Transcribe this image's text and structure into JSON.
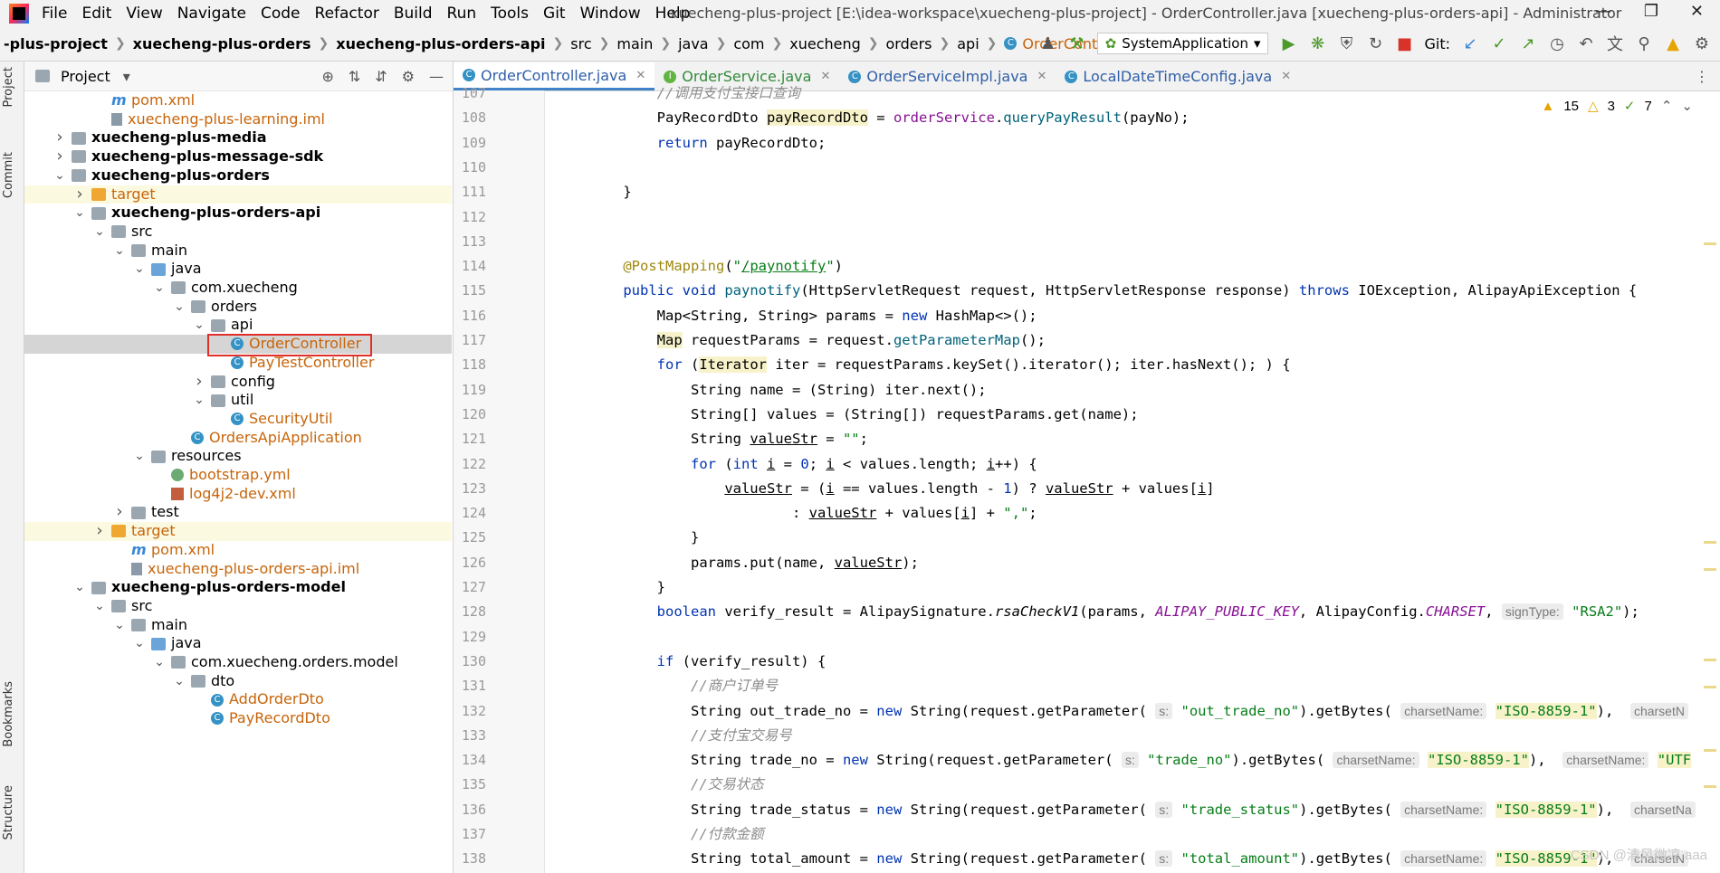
{
  "menubar": {
    "items": [
      "File",
      "Edit",
      "View",
      "Navigate",
      "Code",
      "Refactor",
      "Build",
      "Run",
      "Tools",
      "Git",
      "Window",
      "Help"
    ],
    "window_title": "xuecheng-plus-project [E:\\idea-workspace\\xuecheng-plus-project] - OrderController.java [xuecheng-plus-orders-api] - Administrator"
  },
  "breadcrumbs": [
    "-plus-project",
    "xuecheng-plus-orders",
    "xuecheng-plus-orders-api",
    "src",
    "main",
    "java",
    "com",
    "xuecheng",
    "orders",
    "api",
    "OrderController"
  ],
  "toolbar": {
    "run_config": "SystemApplication",
    "git_label": "Git:"
  },
  "side_tabs": {
    "project": "Project",
    "commit": "Commit",
    "bookmarks": "Bookmarks",
    "structure": "Structure"
  },
  "project_panel": {
    "title": "Project",
    "tree": [
      {
        "text": "pom.xml",
        "indent": 3,
        "icon": "m",
        "color": "orange"
      },
      {
        "text": "xuecheng-plus-learning.iml",
        "indent": 3,
        "icon": "iml",
        "color": "orange"
      },
      {
        "text": "xuecheng-plus-media",
        "indent": 1,
        "icon": "module",
        "chev": "right",
        "bold": true
      },
      {
        "text": "xuecheng-plus-message-sdk",
        "indent": 1,
        "icon": "module",
        "chev": "right",
        "bold": true
      },
      {
        "text": "xuecheng-plus-orders",
        "indent": 1,
        "icon": "module",
        "chev": "down",
        "bold": true
      },
      {
        "text": "target",
        "indent": 2,
        "icon": "folder-orange",
        "chev": "right",
        "color": "orange",
        "hl": "yellow"
      },
      {
        "text": "xuecheng-plus-orders-api",
        "indent": 2,
        "icon": "module",
        "chev": "down",
        "bold": true
      },
      {
        "text": "src",
        "indent": 3,
        "icon": "folder",
        "chev": "down"
      },
      {
        "text": "main",
        "indent": 4,
        "icon": "folder",
        "chev": "down"
      },
      {
        "text": "java",
        "indent": 5,
        "icon": "folder-blue",
        "chev": "down"
      },
      {
        "text": "com.xuecheng",
        "indent": 6,
        "icon": "folder",
        "chev": "down"
      },
      {
        "text": "orders",
        "indent": 7,
        "icon": "folder",
        "chev": "down"
      },
      {
        "text": "api",
        "indent": 8,
        "icon": "folder",
        "chev": "down"
      },
      {
        "text": "OrderController",
        "indent": 9,
        "icon": "cls",
        "color": "orange",
        "hl": "sel",
        "boxed": true
      },
      {
        "text": "PayTestController",
        "indent": 9,
        "icon": "cls",
        "color": "orange"
      },
      {
        "text": "config",
        "indent": 8,
        "icon": "folder",
        "chev": "right"
      },
      {
        "text": "util",
        "indent": 8,
        "icon": "folder",
        "chev": "down"
      },
      {
        "text": "SecurityUtil",
        "indent": 9,
        "icon": "cls",
        "color": "orange"
      },
      {
        "text": "OrdersApiApplication",
        "indent": 7,
        "icon": "cls",
        "color": "orange"
      },
      {
        "text": "resources",
        "indent": 5,
        "icon": "folder",
        "chev": "down"
      },
      {
        "text": "bootstrap.yml",
        "indent": 6,
        "icon": "yml",
        "color": "orange"
      },
      {
        "text": "log4j2-dev.xml",
        "indent": 6,
        "icon": "xml",
        "color": "orange"
      },
      {
        "text": "test",
        "indent": 4,
        "icon": "folder",
        "chev": "right"
      },
      {
        "text": "target",
        "indent": 3,
        "icon": "folder-orange",
        "chev": "right",
        "color": "orange",
        "hl": "yellow"
      },
      {
        "text": "pom.xml",
        "indent": 4,
        "icon": "m",
        "color": "orange"
      },
      {
        "text": "xuecheng-plus-orders-api.iml",
        "indent": 4,
        "icon": "iml",
        "color": "orange"
      },
      {
        "text": "xuecheng-plus-orders-model",
        "indent": 2,
        "icon": "module",
        "chev": "down",
        "bold": true
      },
      {
        "text": "src",
        "indent": 3,
        "icon": "folder",
        "chev": "down"
      },
      {
        "text": "main",
        "indent": 4,
        "icon": "folder",
        "chev": "down"
      },
      {
        "text": "java",
        "indent": 5,
        "icon": "folder-blue",
        "chev": "down"
      },
      {
        "text": "com.xuecheng.orders.model",
        "indent": 6,
        "icon": "folder",
        "chev": "down"
      },
      {
        "text": "dto",
        "indent": 7,
        "icon": "folder",
        "chev": "down"
      },
      {
        "text": "AddOrderDto",
        "indent": 8,
        "icon": "cls",
        "color": "orange"
      },
      {
        "text": "PayRecordDto",
        "indent": 8,
        "icon": "cls",
        "color": "orange"
      }
    ]
  },
  "tabs": [
    {
      "label": "OrderController.java",
      "active": true
    },
    {
      "label": "OrderService.java",
      "green": true
    },
    {
      "label": "OrderServiceImpl.java"
    },
    {
      "label": "LocalDateTimeConfig.java"
    }
  ],
  "inspections": {
    "warnings": "15",
    "weak": "3",
    "ok": "7"
  },
  "code_lines": [
    {
      "n": "107",
      "html": "        <span class=\"cmt\">//调用支付宝接口查询</span>"
    },
    {
      "n": "108",
      "html": "        PayRecordDto <span class=\"hlw\">payRecordDto</span> = <span class=\"fld\">orderService</span>.<span class=\"mth\">queryPayResult</span>(payNo);"
    },
    {
      "n": "109",
      "html": "        <span class=\"kw\">return</span> payRecordDto;"
    },
    {
      "n": "110",
      "html": ""
    },
    {
      "n": "111",
      "html": "    }"
    },
    {
      "n": "112",
      "html": ""
    },
    {
      "n": "113",
      "html": ""
    },
    {
      "n": "114",
      "html": "    <span class=\"ann\">@PostMapping</span>(<span class=\"str\">\"<span class=\"under\">/paynotify</span>\"</span>)"
    },
    {
      "n": "115",
      "html": "    <span class=\"kw\">public void</span> <span class=\"mth\">paynotify</span>(HttpServletRequest request, HttpServletResponse response) <span class=\"kw\">throws</span> IOException, AlipayApiException {"
    },
    {
      "n": "116",
      "html": "        Map&lt;String, String&gt; params = <span class=\"kw\">new</span> HashMap&lt;&gt;();"
    },
    {
      "n": "117",
      "html": "        <span class=\"hlw\">Map</span> requestParams = request.<span class=\"mth\">getParameterMap</span>();"
    },
    {
      "n": "118",
      "html": "        <span class=\"kw\">for</span> (<span class=\"hlw\">Iterator</span> iter = requestParams.keySet().iterator(); iter.hasNext(); ) {"
    },
    {
      "n": "119",
      "html": "            String name = (String) iter.next();"
    },
    {
      "n": "120",
      "html": "            String[] values = (String[]) requestParams.get(name);"
    },
    {
      "n": "121",
      "html": "            String <span class=\"under\">valueStr</span> = <span class=\"str\">\"\"</span>;"
    },
    {
      "n": "122",
      "html": "            <span class=\"kw\">for</span> (<span class=\"kw\">int</span> <span class=\"under\">i</span> = <span class=\"kw\">0</span>; <span class=\"under\">i</span> &lt; values.length; <span class=\"under\">i</span>++) {"
    },
    {
      "n": "123",
      "html": "                <span class=\"under\">valueStr</span> = (<span class=\"under\">i</span> == values.length - <span class=\"kw\">1</span>) ? <span class=\"under\">valueStr</span> + values[<span class=\"under\">i</span>]"
    },
    {
      "n": "124",
      "html": "                        : <span class=\"under\">valueStr</span> + values[<span class=\"under\">i</span>] + <span class=\"str\">\",\"</span>;"
    },
    {
      "n": "125",
      "html": "            }"
    },
    {
      "n": "126",
      "html": "            params.put(name, <span class=\"under\">valueStr</span>);"
    },
    {
      "n": "127",
      "html": "        }"
    },
    {
      "n": "128",
      "html": "        <span class=\"kw\">boolean</span> verify_result = AlipaySignature.<span class=\"ital\">rsaCheckV1</span>(params, <span class=\"ufld\">ALIPAY_PUBLIC_KEY</span>, AlipayConfig.<span class=\"ufld\">CHARSET</span>, <span class=\"hint\">signType:</span> <span class=\"str\">\"RSA2\"</span>);"
    },
    {
      "n": "129",
      "html": ""
    },
    {
      "n": "130",
      "html": "        <span class=\"kw\">if</span> (verify_result) {"
    },
    {
      "n": "131",
      "html": "            <span class=\"cmt\">//商户订单号</span>"
    },
    {
      "n": "132",
      "html": "            String out_trade_no = <span class=\"kw\">new</span> String(request.getParameter( <span class=\"hint\">s:</span> <span class=\"str\">\"out_trade_no\"</span>).getBytes( <span class=\"hint\">charsetName:</span> <span class=\"str hlw\">\"ISO-8859-1\"</span>),  <span class=\"hint\">charsetN</span>"
    },
    {
      "n": "133",
      "html": "            <span class=\"cmt\">//支付宝交易号</span>"
    },
    {
      "n": "134",
      "html": "            String trade_no = <span class=\"kw\">new</span> String(request.getParameter( <span class=\"hint\">s:</span> <span class=\"str\">\"trade_no\"</span>).getBytes( <span class=\"hint\">charsetName:</span> <span class=\"str hlw\">\"ISO-8859-1\"</span>),  <span class=\"hint\">charsetName:</span> <span class=\"str hlw\">\"UTF</span>"
    },
    {
      "n": "135",
      "html": "            <span class=\"cmt\">//交易状态</span>"
    },
    {
      "n": "136",
      "html": "            String trade_status = <span class=\"kw\">new</span> String(request.getParameter( <span class=\"hint\">s:</span> <span class=\"str\">\"trade_status\"</span>).getBytes( <span class=\"hint\">charsetName:</span> <span class=\"str hlw\">\"ISO-8859-1\"</span>),  <span class=\"hint\">charsetNa</span>"
    },
    {
      "n": "137",
      "html": "            <span class=\"cmt\">//付款金额</span>"
    },
    {
      "n": "138",
      "html": "            String total_amount = <span class=\"kw\">new</span> String(request.getParameter( <span class=\"hint\">s:</span> <span class=\"str\">\"total_amount\"</span>).getBytes( <span class=\"hint\">charsetName:</span> <span class=\"str hlw\">\"ISO-8859-1\"</span>),  <span class=\"hint\">charsetN</span>"
    }
  ],
  "watermark": "CSDN @清风微凉 aaa"
}
